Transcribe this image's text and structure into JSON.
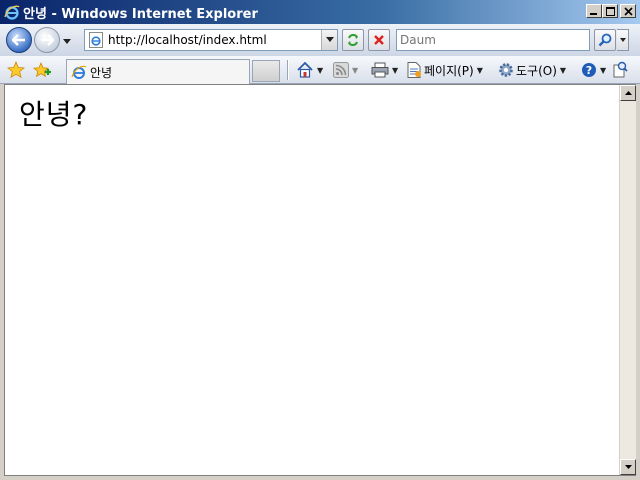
{
  "window": {
    "title": "안녕 - Windows Internet Explorer",
    "title_bar_color": "#0a246a"
  },
  "toolbar": {
    "address": "http://localhost/index.html",
    "search_placeholder": "Daum"
  },
  "tabs": [
    {
      "label": "안녕",
      "active": true
    }
  ],
  "commands": {
    "page_label": "페이지(P)",
    "tools_label": "도구(O)"
  },
  "icons": {
    "back": "back-arrow-icon",
    "forward": "forward-arrow-icon",
    "refresh": "refresh-icon",
    "stop": "stop-icon",
    "search": "search-icon",
    "favorites": "star-icon",
    "add_favorites": "add-favorite-icon",
    "home": "home-icon",
    "feeds": "rss-icon",
    "print": "printer-icon",
    "page": "page-icon",
    "tools": "gear-icon",
    "help": "help-icon",
    "research": "research-icon"
  },
  "content": {
    "heading": "안녕?"
  }
}
